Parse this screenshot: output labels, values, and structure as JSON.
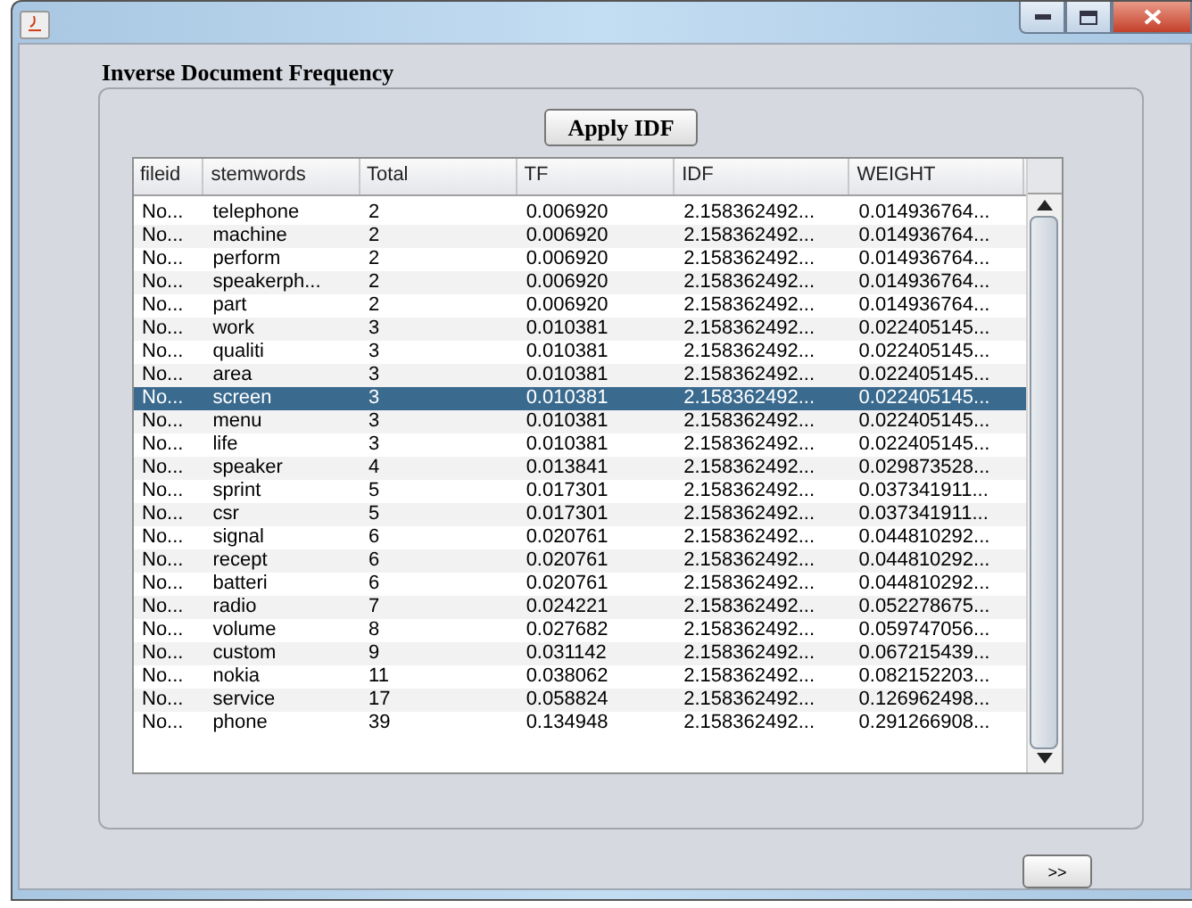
{
  "panel": {
    "title": "Inverse Document Frequency"
  },
  "apply_button": "Apply IDF",
  "table": {
    "columns": [
      "fileid",
      "stemwords",
      "Total",
      "TF",
      "IDF",
      "WEIGHT"
    ],
    "rows": [
      {
        "cells": [
          "No...",
          "telephone",
          "2",
          "0.006920",
          "2.158362492...",
          "0.014936764..."
        ],
        "selected": false
      },
      {
        "cells": [
          "No...",
          "machine",
          "2",
          "0.006920",
          "2.158362492...",
          "0.014936764..."
        ],
        "selected": false
      },
      {
        "cells": [
          "No...",
          "perform",
          "2",
          "0.006920",
          "2.158362492...",
          "0.014936764..."
        ],
        "selected": false
      },
      {
        "cells": [
          "No...",
          "speakerph...",
          "2",
          "0.006920",
          "2.158362492...",
          "0.014936764..."
        ],
        "selected": false
      },
      {
        "cells": [
          "No...",
          "part",
          "2",
          "0.006920",
          "2.158362492...",
          "0.014936764..."
        ],
        "selected": false
      },
      {
        "cells": [
          "No...",
          "work",
          "3",
          "0.010381",
          "2.158362492...",
          "0.022405145..."
        ],
        "selected": false
      },
      {
        "cells": [
          "No...",
          "qualiti",
          "3",
          "0.010381",
          "2.158362492...",
          "0.022405145..."
        ],
        "selected": false
      },
      {
        "cells": [
          "No...",
          "area",
          "3",
          "0.010381",
          "2.158362492...",
          "0.022405145..."
        ],
        "selected": false
      },
      {
        "cells": [
          "No...",
          "screen",
          "3",
          "0.010381",
          "2.158362492...",
          "0.022405145..."
        ],
        "selected": true
      },
      {
        "cells": [
          "No...",
          "menu",
          "3",
          "0.010381",
          "2.158362492...",
          "0.022405145..."
        ],
        "selected": false
      },
      {
        "cells": [
          "No...",
          "life",
          "3",
          "0.010381",
          "2.158362492...",
          "0.022405145..."
        ],
        "selected": false
      },
      {
        "cells": [
          "No...",
          "speaker",
          "4",
          "0.013841",
          "2.158362492...",
          "0.029873528..."
        ],
        "selected": false
      },
      {
        "cells": [
          "No...",
          "sprint",
          "5",
          "0.017301",
          "2.158362492...",
          "0.037341911..."
        ],
        "selected": false
      },
      {
        "cells": [
          "No...",
          "csr",
          "5",
          "0.017301",
          "2.158362492...",
          "0.037341911..."
        ],
        "selected": false
      },
      {
        "cells": [
          "No...",
          "signal",
          "6",
          "0.020761",
          "2.158362492...",
          "0.044810292..."
        ],
        "selected": false
      },
      {
        "cells": [
          "No...",
          "recept",
          "6",
          "0.020761",
          "2.158362492...",
          "0.044810292..."
        ],
        "selected": false
      },
      {
        "cells": [
          "No...",
          "batteri",
          "6",
          "0.020761",
          "2.158362492...",
          "0.044810292..."
        ],
        "selected": false
      },
      {
        "cells": [
          "No...",
          "radio",
          "7",
          "0.024221",
          "2.158362492...",
          "0.052278675..."
        ],
        "selected": false
      },
      {
        "cells": [
          "No...",
          "volume",
          "8",
          "0.027682",
          "2.158362492...",
          "0.059747056..."
        ],
        "selected": false
      },
      {
        "cells": [
          "No...",
          "custom",
          "9",
          "0.031142",
          "2.158362492...",
          "0.067215439..."
        ],
        "selected": false
      },
      {
        "cells": [
          "No...",
          "nokia",
          "11",
          "0.038062",
          "2.158362492...",
          "0.082152203..."
        ],
        "selected": false
      },
      {
        "cells": [
          "No...",
          "service",
          "17",
          "0.058824",
          "2.158362492...",
          "0.126962498..."
        ],
        "selected": false
      },
      {
        "cells": [
          "No...",
          "phone",
          "39",
          "0.134948",
          "2.158362492...",
          "0.291266908..."
        ],
        "selected": false
      }
    ]
  },
  "next_button": ">>"
}
